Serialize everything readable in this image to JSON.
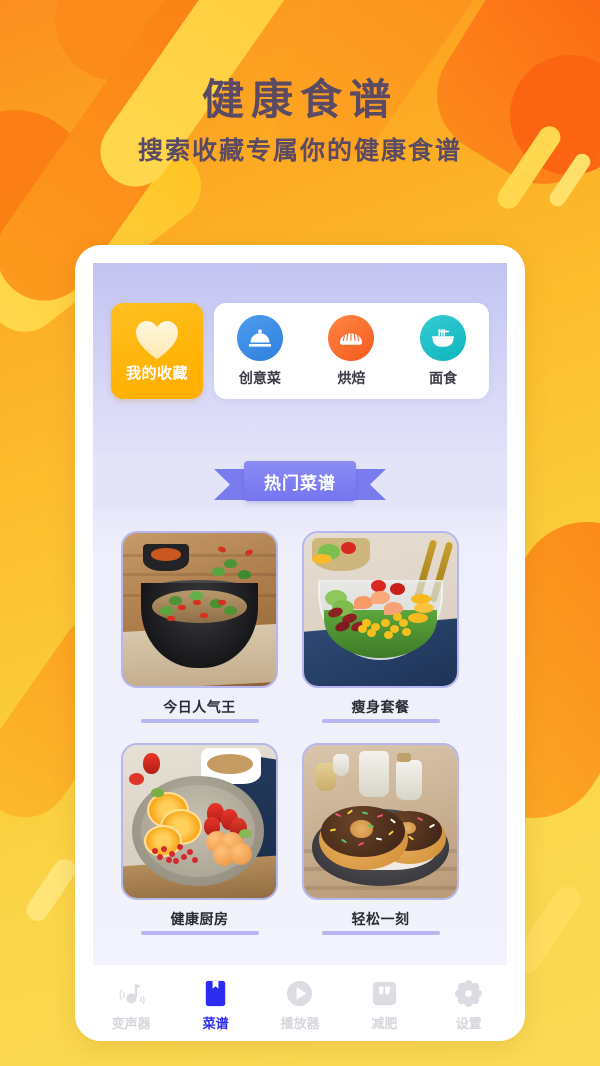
{
  "hero": {
    "title": "健康食谱",
    "subtitle": "搜索收藏专属你的健康食谱",
    "title_color": "#5b4a63",
    "bg_start": "#fb8e1f",
    "bg_end": "#fada55"
  },
  "categories": {
    "favorite": {
      "label": "我的收藏",
      "icon": "heart-icon",
      "bg_color": "#ffb408"
    },
    "items": [
      {
        "label": "创意菜",
        "icon": "cloche-icon",
        "color": "#3f8de6"
      },
      {
        "label": "烘焙",
        "icon": "bread-icon",
        "color": "#f66f2c"
      },
      {
        "label": "面食",
        "icon": "noodle-bowl-icon",
        "color": "#1cc0c7"
      }
    ]
  },
  "banner": {
    "label": "热门菜谱",
    "ribbon_color": "#7b7bf0",
    "band_color": "#e3e4f7"
  },
  "recipes": [
    {
      "label": "今日人气王",
      "art": "noodle-bowl"
    },
    {
      "label": "瘦身套餐",
      "art": "shrimp-salad"
    },
    {
      "label": "健康厨房",
      "art": "fruit-plate"
    },
    {
      "label": "轻松一刻",
      "art": "donuts"
    }
  ],
  "nav": {
    "active_color": "#2d2df0",
    "inactive_color": "#d6d6dd",
    "items": [
      {
        "label": "变声器",
        "icon": "voice-changer-icon",
        "active": false
      },
      {
        "label": "菜谱",
        "icon": "recipe-book-icon",
        "active": true
      },
      {
        "label": "播放器",
        "icon": "play-icon",
        "active": false
      },
      {
        "label": "减肥",
        "icon": "weight-scale-icon",
        "active": false
      },
      {
        "label": "设置",
        "icon": "gear-icon",
        "active": false
      }
    ]
  }
}
